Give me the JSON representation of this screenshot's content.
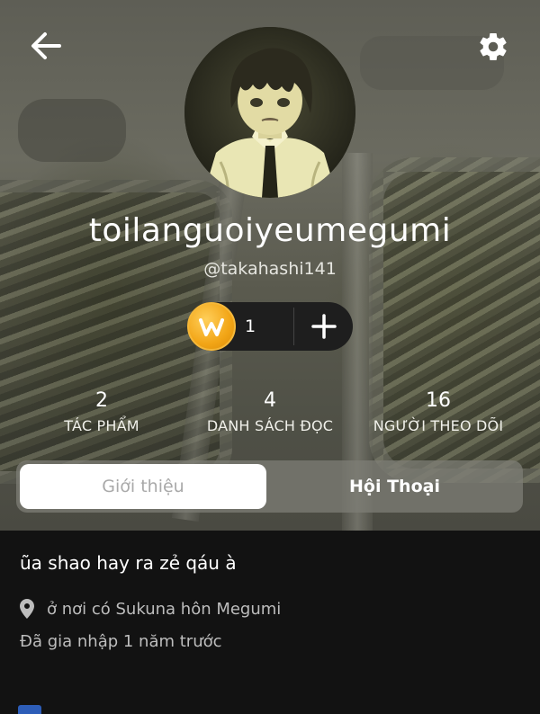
{
  "profile": {
    "display_name": "toilanguoiyeumegumi",
    "handle": "@takahashi141",
    "coins": "1"
  },
  "icons": {
    "back": "arrow-left-icon",
    "settings": "gear-icon",
    "coin": "coin-icon",
    "add": "plus-icon",
    "location": "map-pin-icon"
  },
  "stats": [
    {
      "value": "2",
      "label": "TÁC PHẨM"
    },
    {
      "value": "4",
      "label": "DANH SÁCH ĐỌC"
    },
    {
      "value": "16",
      "label": "NGƯỜI THEO DÕI"
    }
  ],
  "tabs": {
    "intro": "Giới thiệu",
    "chat": "Hội Thoại",
    "selected": "intro"
  },
  "about": {
    "bio": "ũa shao hay ra zẻ qáu à",
    "location": "ở nơi có Sukuna hôn Megumi",
    "joined": "Đã gia nhập 1 năm trước"
  },
  "colors": {
    "coin": "#f2a516",
    "content_bg": "#121212",
    "tab_active_bg": "#ffffff"
  }
}
